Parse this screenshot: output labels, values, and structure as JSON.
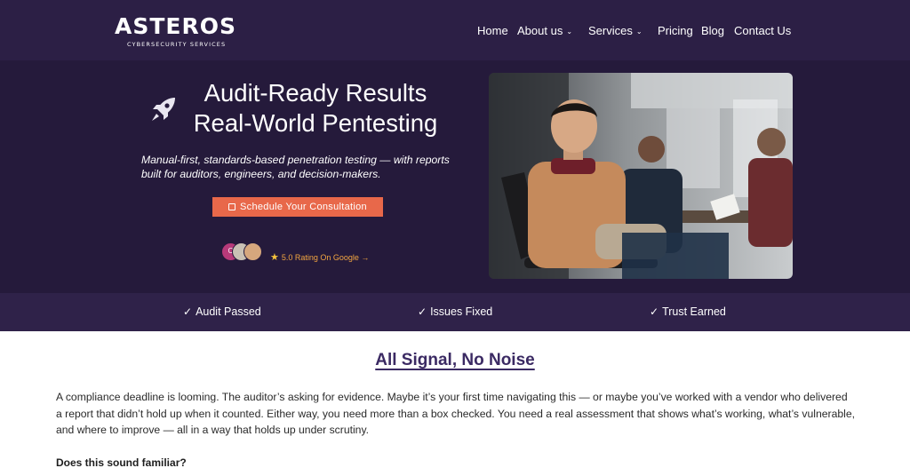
{
  "brand": {
    "name": "ASTEROS",
    "tagline": "CYBERSECURITY SERVICES"
  },
  "nav": {
    "items": [
      {
        "label": "Home",
        "has_dropdown": false
      },
      {
        "label": "About us",
        "has_dropdown": true
      },
      {
        "label": "Services",
        "has_dropdown": true
      },
      {
        "label": "Pricing",
        "has_dropdown": false
      },
      {
        "label": "Blog",
        "has_dropdown": false
      },
      {
        "label": "Contact Us",
        "has_dropdown": false
      }
    ],
    "dropdown_glyph": "⌄"
  },
  "hero": {
    "icon": "rocket-icon",
    "title_line1": "Audit-Ready Results",
    "title_line2": "Real-World Pentesting",
    "subtitle": "Manual-first, standards-based penetration testing — with reports built for auditors, engineers, and decision-makers.",
    "cta_label": "Schedule Your Consultation",
    "cta_icon": "calendar-icon",
    "avatar_initial": "C",
    "rating_text": "5.0 Rating On Google →",
    "rating_icon": "star-icon",
    "photo": "team-meeting-photo"
  },
  "benefits": [
    {
      "label": "Audit Passed",
      "icon": "check-icon"
    },
    {
      "label": "Issues Fixed",
      "icon": "check-icon"
    },
    {
      "label": "Trust Earned",
      "icon": "check-icon"
    }
  ],
  "content": {
    "heading": "All Signal, No Noise",
    "paragraph": "A compliance deadline is looming. The auditor’s asking for evidence. Maybe it’s your first time navigating this — or maybe you’ve worked with a vendor who delivered a report that didn’t hold up when it counted. Either way, you need more than a box checked. You need a real assessment that shows what’s working, what’s vulnerable, and where to improve — all in a way that holds up under scrutiny.",
    "question": "Does this sound familiar?"
  },
  "colors": {
    "header_bg": "#2c1f45",
    "hero_bg": "#251a3b",
    "bar_bg": "#2f2249",
    "accent": "#e8684a",
    "heading": "#3b2a63",
    "rating": "#f2a541"
  }
}
